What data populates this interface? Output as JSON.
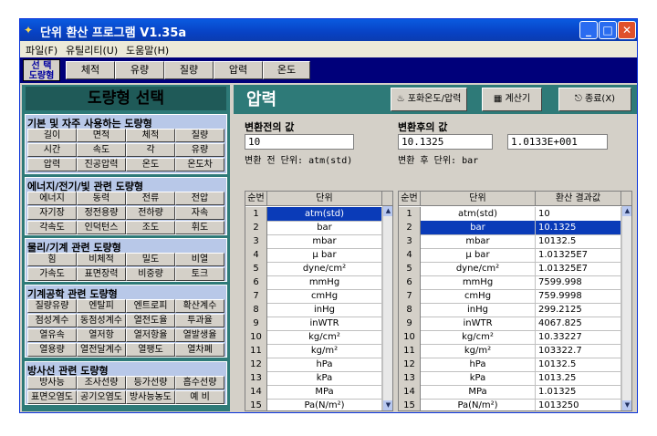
{
  "window": {
    "title": "단위 환산 프로그램 V1.35a",
    "icon": "app-icon"
  },
  "menu": [
    "파일(F)",
    "유틸리티(U)",
    "도움말(H)"
  ],
  "nav": {
    "selector_line1": "선 택",
    "selector_line2": "도량형",
    "tabs": [
      "체적",
      "유량",
      "질량",
      "압력",
      "온도"
    ]
  },
  "left": {
    "title": "도량형 선택",
    "groups": [
      {
        "title": "기본 및 자주 사용하는 도량형",
        "items": [
          "길이",
          "면적",
          "체적",
          "질량",
          "시간",
          "속도",
          "각",
          "유량",
          "압력",
          "진공압력",
          "온도",
          "온도차"
        ]
      },
      {
        "title": "에너지/전기/빛 관련 도량형",
        "items": [
          "에너지",
          "동력",
          "전류",
          "전압",
          "자기장",
          "정전용량",
          "전하량",
          "자속",
          "각속도",
          "인덕턴스",
          "조도",
          "휘도"
        ]
      },
      {
        "title": "물리/기계 관련 도량형",
        "items": [
          "힘",
          "비체적",
          "밀도",
          "비열",
          "가속도",
          "표면장력",
          "비중량",
          "토크"
        ]
      },
      {
        "title": "기계공학 관련 도량형",
        "items": [
          "질량유량",
          "엔탈피",
          "엔트로피",
          "확산계수",
          "점성계수",
          "동점성계수",
          "열전도율",
          "투과율",
          "열유속",
          "열저항",
          "열저항율",
          "열발생율",
          "열용량",
          "열전달계수",
          "열팽도",
          "열차폐"
        ]
      },
      {
        "title": "방사선 관련 도량형",
        "items": [
          "방사능",
          "조사선량",
          "등가선량",
          "흡수선량",
          "표면오염도",
          "공기오염도",
          "방사능농도",
          "예 비"
        ]
      }
    ]
  },
  "right": {
    "title": "압력",
    "buttons": [
      "포화온도/압력",
      "계산기",
      "종료(X)"
    ],
    "before_label": "변환전의 값",
    "after_label": "변환후의 값",
    "before_value": "10",
    "after_value": "10.1325",
    "after_value_exp": "1.0133E+001",
    "before_unit_label": "변환 전 단위: atm(std)",
    "after_unit_label": "변환 후 단위: bar",
    "left_grid": {
      "headers": [
        "순번",
        "단위"
      ],
      "rows": [
        [
          "1",
          "atm(std)"
        ],
        [
          "2",
          "bar"
        ],
        [
          "3",
          "mbar"
        ],
        [
          "4",
          "μ bar"
        ],
        [
          "5",
          "dyne/cm²"
        ],
        [
          "6",
          "mmHg"
        ],
        [
          "7",
          "cmHg"
        ],
        [
          "8",
          "inHg"
        ],
        [
          "9",
          "inWTR"
        ],
        [
          "10",
          "kg/cm²"
        ],
        [
          "11",
          "kg/m²"
        ],
        [
          "12",
          "hPa"
        ],
        [
          "13",
          "kPa"
        ],
        [
          "14",
          "MPa"
        ],
        [
          "15",
          "Pa(N/m²)"
        ]
      ]
    },
    "right_grid": {
      "headers": [
        "순번",
        "단위",
        "환산 결과값"
      ],
      "rows": [
        [
          "1",
          "atm(std)",
          "10"
        ],
        [
          "2",
          "bar",
          "10.1325"
        ],
        [
          "3",
          "mbar",
          "10132.5"
        ],
        [
          "4",
          "μ bar",
          "1.01325E7"
        ],
        [
          "5",
          "dyne/cm²",
          "1.01325E7"
        ],
        [
          "6",
          "mmHg",
          "7599.998"
        ],
        [
          "7",
          "cmHg",
          "759.9998"
        ],
        [
          "8",
          "inHg",
          "299.2125"
        ],
        [
          "9",
          "inWTR",
          "4067.825"
        ],
        [
          "10",
          "kg/cm²",
          "10.33227"
        ],
        [
          "11",
          "kg/m²",
          "103322.7"
        ],
        [
          "12",
          "hPa",
          "10132.5"
        ],
        [
          "13",
          "kPa",
          "1013.25"
        ],
        [
          "14",
          "MPa",
          "1.01325"
        ],
        [
          "15",
          "Pa(N/m²)",
          "1013250"
        ]
      ]
    }
  }
}
